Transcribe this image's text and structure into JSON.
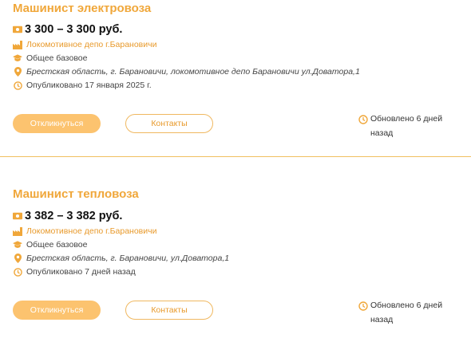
{
  "vacancies": [
    {
      "title": "Машинист электровоза",
      "salary": "3 300 – 3 300 руб.",
      "employer": "Локомотивное депо г.Барановичи",
      "education": "Общее базовое",
      "address": "Брестская область, г. Барановичи, локомотивное депо Барановичи ул.Доватора,1",
      "published": "Опубликовано 17 января 2025 г.",
      "respond_label": "Откликнуться",
      "contacts_label": "Контакты",
      "updated": "Обновлено 6 дней назад"
    },
    {
      "title": "Машинист тепловоза",
      "salary": "3 382 – 3 382 руб.",
      "employer": "Локомотивное депо г.Барановичи",
      "education": "Общее базовое",
      "address": "Брестская область, г. Барановичи, ул.Доватора,1",
      "published": "Опубликовано 7 дней назад",
      "respond_label": "Откликнуться",
      "contacts_label": "Контакты",
      "updated": "Обновлено 6 дней назад"
    }
  ],
  "icons": {
    "salary": "money-icon",
    "employer": "factory-icon",
    "education": "graduation-cap-icon",
    "address": "location-pin-icon",
    "published": "clock-icon",
    "updated": "clock-icon"
  },
  "colors": {
    "accent": "#f0a73a",
    "button_fill": "#fcc36f",
    "link": "#e89a2c"
  }
}
